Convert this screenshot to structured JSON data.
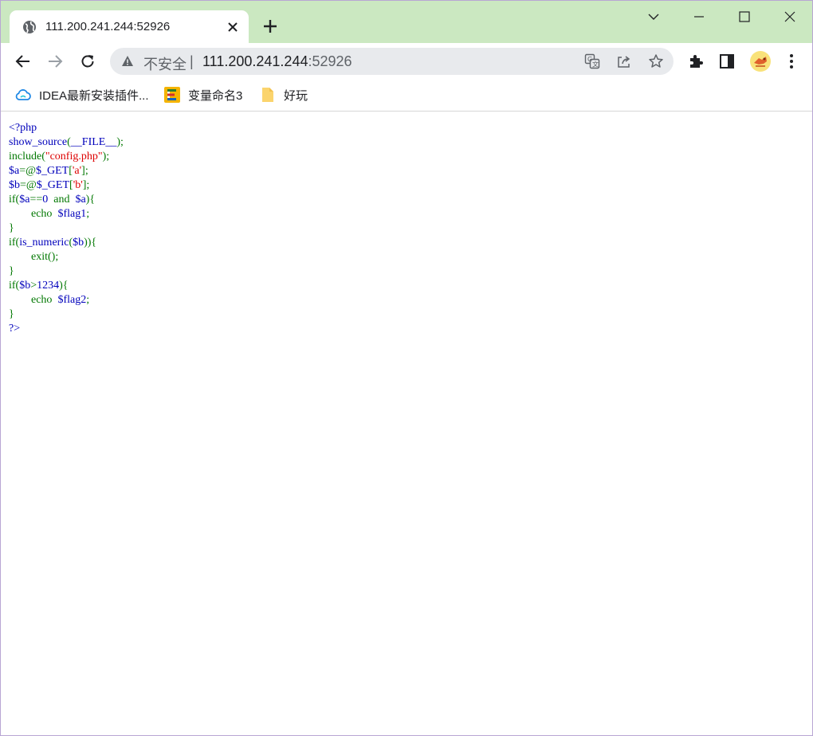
{
  "tab": {
    "title": "111.200.241.244:52926",
    "favicon_icon": "globe-icon",
    "close_icon": "close-icon"
  },
  "new_tab_icon": "plus-icon",
  "window_controls": [
    "chevron-down-icon",
    "minimize-icon",
    "maximize-icon",
    "close-icon"
  ],
  "toolbar": {
    "back_icon": "back-arrow-icon",
    "forward_icon": "forward-arrow-icon",
    "reload_icon": "reload-icon",
    "omnibox": {
      "insecure_label": "不安全",
      "separator": "|",
      "url_host": "111.200.241.244",
      "url_port": ":52926"
    },
    "right_icons": [
      "translate-icon",
      "share-icon",
      "star-icon",
      "extensions-icon",
      "side-panel-icon",
      "avatar",
      "menu-icon"
    ]
  },
  "bookmarks": [
    {
      "label": "IDEA最新安装插件...",
      "icon": "cloud-icon"
    },
    {
      "label": "变量命名3",
      "icon": "app-icon"
    },
    {
      "label": "好玩",
      "icon": "folder-icon"
    }
  ],
  "code_lines": [
    [
      {
        "t": "<?php",
        "c": "def"
      }
    ],
    [
      {
        "t": "show_source",
        "c": "def"
      },
      {
        "t": "(",
        "c": "kw"
      },
      {
        "t": "__FILE__",
        "c": "def"
      },
      {
        "t": ");",
        "c": "kw"
      }
    ],
    [
      {
        "t": "include(",
        "c": "kw"
      },
      {
        "t": "\"config.php\"",
        "c": "str"
      },
      {
        "t": ");",
        "c": "kw"
      }
    ],
    [
      {
        "t": "$a",
        "c": "def"
      },
      {
        "t": "=@",
        "c": "kw"
      },
      {
        "t": "$_GET",
        "c": "def"
      },
      {
        "t": "[",
        "c": "kw"
      },
      {
        "t": "'a'",
        "c": "str"
      },
      {
        "t": "];",
        "c": "kw"
      }
    ],
    [
      {
        "t": "$b",
        "c": "def"
      },
      {
        "t": "=@",
        "c": "kw"
      },
      {
        "t": "$_GET",
        "c": "def"
      },
      {
        "t": "[",
        "c": "kw"
      },
      {
        "t": "'b'",
        "c": "str"
      },
      {
        "t": "];",
        "c": "kw"
      }
    ],
    [
      {
        "t": "if(",
        "c": "kw"
      },
      {
        "t": "$a",
        "c": "def"
      },
      {
        "t": "==",
        "c": "kw"
      },
      {
        "t": "0",
        "c": "def"
      },
      {
        "t": "  and  ",
        "c": "kw"
      },
      {
        "t": "$a",
        "c": "def"
      },
      {
        "t": "){",
        "c": "kw"
      }
    ],
    [
      {
        "t": "        echo  ",
        "c": "kw"
      },
      {
        "t": "$flag1",
        "c": "def"
      },
      {
        "t": ";",
        "c": "kw"
      }
    ],
    [
      {
        "t": "}",
        "c": "kw"
      }
    ],
    [
      {
        "t": "if(",
        "c": "kw"
      },
      {
        "t": "is_numeric",
        "c": "def"
      },
      {
        "t": "(",
        "c": "kw"
      },
      {
        "t": "$b",
        "c": "def"
      },
      {
        "t": ")){",
        "c": "kw"
      }
    ],
    [
      {
        "t": "        ",
        "c": "kw"
      },
      {
        "t": "exit",
        "c": "kw"
      },
      {
        "t": "();",
        "c": "kw"
      }
    ],
    [
      {
        "t": "}",
        "c": "kw"
      }
    ],
    [
      {
        "t": "if(",
        "c": "kw"
      },
      {
        "t": "$b",
        "c": "def"
      },
      {
        "t": ">",
        "c": "kw"
      },
      {
        "t": "1234",
        "c": "def"
      },
      {
        "t": "){",
        "c": "kw"
      }
    ],
    [
      {
        "t": "        echo  ",
        "c": "kw"
      },
      {
        "t": "$flag2",
        "c": "def"
      },
      {
        "t": ";",
        "c": "kw"
      }
    ],
    [
      {
        "t": "}",
        "c": "kw"
      }
    ],
    [
      {
        "t": "?>",
        "c": "def"
      }
    ]
  ],
  "colors": {
    "tabstrip_bg": "#cbe8c1",
    "code_default": "#0000bb",
    "code_keyword": "#007700",
    "code_string": "#dd0000"
  }
}
